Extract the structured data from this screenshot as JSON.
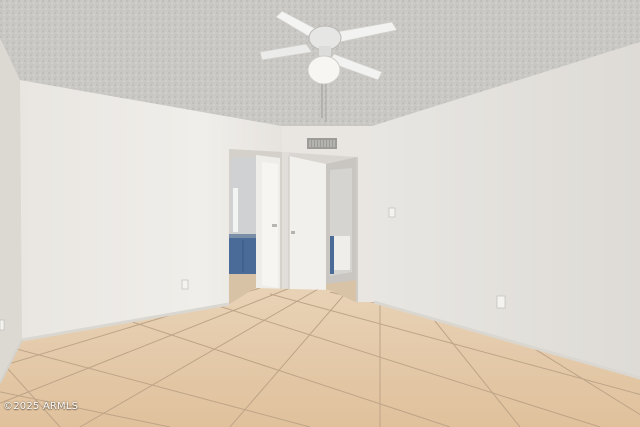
{
  "watermark": {
    "text": "©2025 ARMLS"
  },
  "colors": {
    "ceiling": "#c9c7c3",
    "wall_light": "#eceae6",
    "wall_shade": "#dcd8d2",
    "floor_tile": "#e4c9a8",
    "grout": "#b89f82",
    "door": "#f2f0ec",
    "vanity": "#4a6a98"
  }
}
